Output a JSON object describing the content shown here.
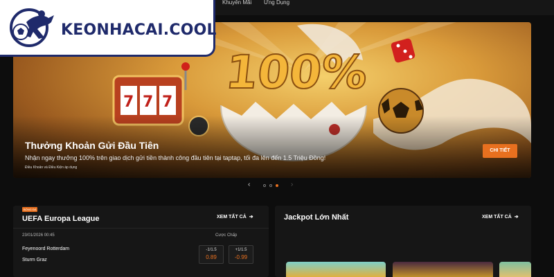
{
  "nav": {
    "items": [
      "Khuyến Mãi",
      "Ứng Dụng"
    ]
  },
  "logo": {
    "text": "KEONHACAI.COOL"
  },
  "hero": {
    "art_text": "100%",
    "title": "Thưởng Khoản Gửi Đầu Tiên",
    "description": "Nhận ngay thưởng 100% trên giao dịch gửi tiền thành công đầu tiên tại taptap, tối đa lên đến 1.5 Triệu Đồng!",
    "terms": "Điều Khoản và Điều Kiện áp dụng",
    "cta": "CHI TIẾT",
    "slides_total": 3,
    "active_slide": 3
  },
  "europa": {
    "badge": "BÓNG ĐÁ",
    "title": "UEFA Europa League",
    "see_all": "XEM TẤT CẢ",
    "datetime": "23/01/2026 00:45",
    "odds_header": "Cược Chấp",
    "home_team": "Feyenoord Rotterdam",
    "away_team": "Sturm Graz",
    "odds": [
      {
        "handicap": "-1/1.5",
        "price": "0.89"
      },
      {
        "handicap": "+1/1.5",
        "price": "-0.99"
      }
    ]
  },
  "jackpot": {
    "title": "Jackpot Lớn Nhất",
    "see_all": "XEM TẤT CẢ"
  },
  "colors": {
    "accent": "#e8701f",
    "brand": "#1f2a6b",
    "background": "#0d0d0d",
    "card": "#161616"
  }
}
